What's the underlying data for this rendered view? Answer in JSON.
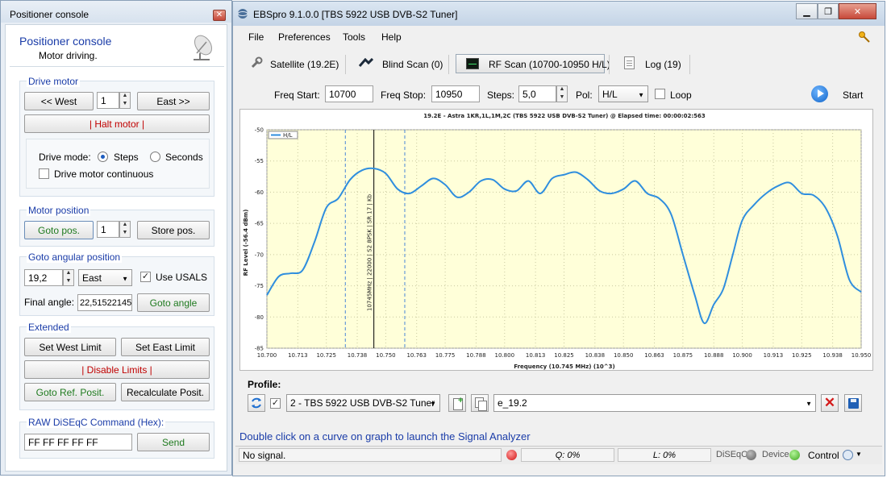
{
  "positioner": {
    "window_title": "Positioner console",
    "header_title": "Positioner console",
    "header_status": "Motor driving.",
    "drive_motor": {
      "title": "Drive motor",
      "west_button": "<< West",
      "step_value": "1",
      "east_button": "East >>",
      "halt_button": "| Halt motor |",
      "drive_mode_label": "Drive mode:",
      "steps_option": "Steps",
      "seconds_option": "Seconds",
      "continuous_label": "Drive motor continuous"
    },
    "motor_position": {
      "title": "Motor position",
      "goto_button": "Goto pos.",
      "position_value": "1",
      "store_button": "Store pos."
    },
    "goto_angular": {
      "title": "Goto angular position",
      "angle_value": "19,2",
      "direction_value": "East",
      "usals_label": "Use USALS",
      "final_angle_label": "Final angle:",
      "final_angle_value": "22,51522145",
      "goto_angle_button": "Goto angle"
    },
    "extended": {
      "title": "Extended",
      "set_west_button": "Set West Limit",
      "set_east_button": "Set East Limit",
      "disable_limits_button": "| Disable Limits |",
      "goto_ref_button": "Goto Ref. Posit.",
      "recalculate_button": "Recalculate Posit."
    },
    "raw_diseqc": {
      "title": "RAW DiSEqC Command (Hex):",
      "command_value": "FF FF FF FF FF",
      "send_button": "Send"
    }
  },
  "main": {
    "window_title": "EBSpro 9.1.0.0 [TBS 5922 USB DVB-S2 Tuner]",
    "menu": [
      "File",
      "Preferences",
      "Tools",
      "Help"
    ],
    "tabs": {
      "satellite": "Satellite (19.2E)",
      "blind_scan": "Blind Scan (0)",
      "rf_scan": "RF Scan (10700-10950 H/L)",
      "log": "Log (19)"
    },
    "scan_params": {
      "freq_start_label": "Freq Start:",
      "freq_start_value": "10700",
      "freq_stop_label": "Freq Stop:",
      "freq_stop_value": "10950",
      "steps_label": "Steps:",
      "steps_value": "5,0",
      "pol_label": "Pol:",
      "pol_value": "H/L",
      "loop_label": "Loop",
      "start_label": "Start"
    },
    "profile": {
      "label": "Profile:",
      "tuner_value": "2 - TBS 5922 USB DVB-S2 Tuner",
      "name_value": "e_19.2"
    },
    "hint": "Double click on a curve on graph to launch the Signal Analyzer",
    "status": {
      "message": "No signal.",
      "quality": "Q: 0%",
      "level": "L: 0%",
      "diseqc": "DiSEqC",
      "device": "Device",
      "control": "Control"
    }
  },
  "chart_data": {
    "type": "line",
    "title": "19.2E - Astra 1KR,1L,1M,2C (TBS 5922 USB DVB-S2 Tuner) @ Elapsed time: 00:00:02:563",
    "xlabel": "Frequency (10.745 MHz) (10^3)",
    "ylabel": "RF Level (-56.4 dBm)",
    "legend": "H/L",
    "legend_position": "top-left",
    "grid": true,
    "xlim": [
      10.7,
      10.95
    ],
    "ylim": [
      -85,
      -50
    ],
    "x_ticks": [
      "10.700",
      "10.713",
      "10.725",
      "10.738",
      "10.750",
      "10.763",
      "10.775",
      "10.788",
      "10.800",
      "10.813",
      "10.825",
      "10.838",
      "10.850",
      "10.863",
      "10.875",
      "10.888",
      "10.900",
      "10.913",
      "10.925",
      "10.938",
      "10.950"
    ],
    "y_ticks": [
      -50,
      -55,
      -60,
      -65,
      -70,
      -75,
      -80,
      -85
    ],
    "marker_label": "10745MHz | 22000 | S2 8PSK | SR 17 | Kb",
    "marker_x": 10.745,
    "dashed_markers": [
      10.733,
      10.758
    ],
    "series": [
      {
        "name": "H/L",
        "color": "#2f8ede",
        "x": [
          10.7,
          10.705,
          10.71,
          10.715,
          10.72,
          10.725,
          10.73,
          10.735,
          10.74,
          10.745,
          10.75,
          10.755,
          10.76,
          10.765,
          10.77,
          10.775,
          10.78,
          10.785,
          10.79,
          10.795,
          10.8,
          10.805,
          10.81,
          10.815,
          10.82,
          10.825,
          10.83,
          10.835,
          10.84,
          10.845,
          10.85,
          10.855,
          10.86,
          10.865,
          10.87,
          10.875,
          10.88,
          10.884,
          10.888,
          10.892,
          10.896,
          10.9,
          10.905,
          10.91,
          10.915,
          10.92,
          10.925,
          10.93,
          10.935,
          10.94,
          10.945,
          10.95
        ],
        "y": [
          -76.5,
          -73.5,
          -73.0,
          -72.5,
          -68.0,
          -62.5,
          -61.0,
          -58.0,
          -56.5,
          -56.2,
          -57.0,
          -59.5,
          -60.2,
          -59.0,
          -57.8,
          -58.8,
          -60.8,
          -60.0,
          -58.2,
          -58.0,
          -59.5,
          -59.8,
          -58.2,
          -60.2,
          -57.8,
          -57.2,
          -56.8,
          -58.0,
          -59.8,
          -60.2,
          -59.5,
          -58.2,
          -60.2,
          -61.0,
          -63.5,
          -70.0,
          -76.5,
          -81.0,
          -78.0,
          -75.5,
          -70.0,
          -64.5,
          -62.0,
          -60.2,
          -59.0,
          -58.5,
          -60.2,
          -60.5,
          -62.5,
          -67.0,
          -74.0,
          -76.0
        ]
      }
    ]
  }
}
